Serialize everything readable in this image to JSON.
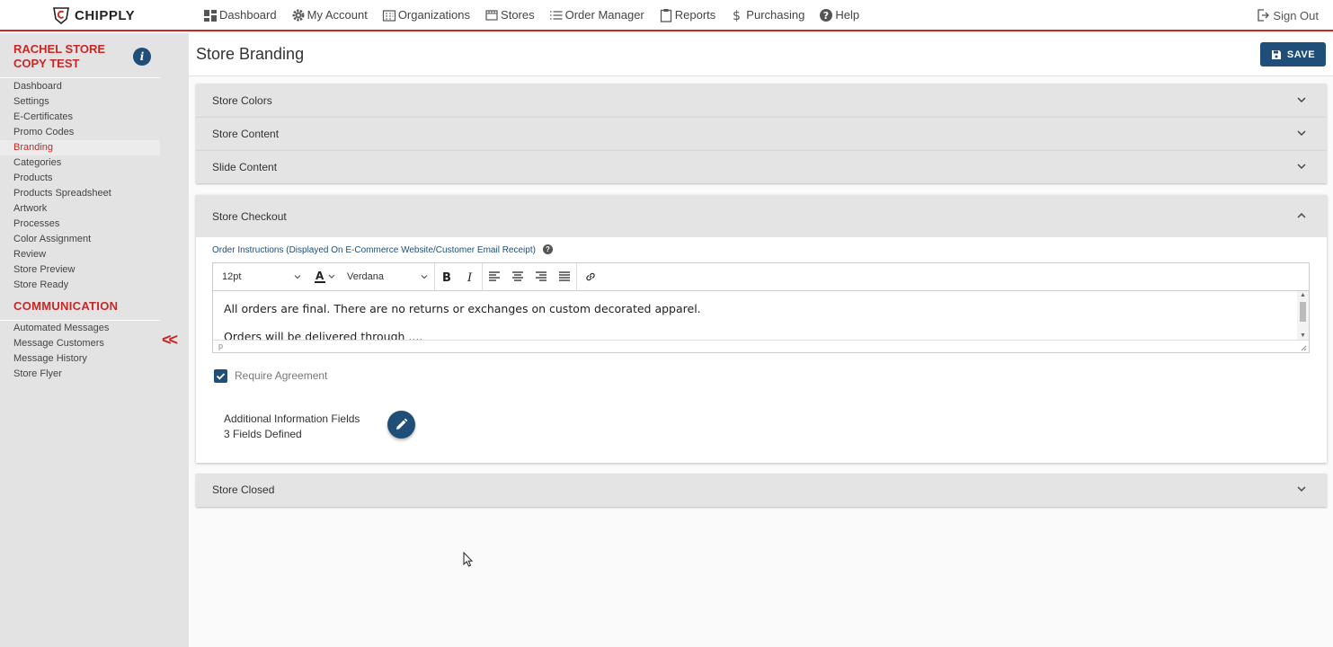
{
  "brand": {
    "name": "CHIPPLY",
    "accent_red": "#c62828",
    "primary_blue": "#1f4e79"
  },
  "nav": {
    "items": [
      {
        "label": "Dashboard",
        "icon": "dashboard-icon"
      },
      {
        "label": "My Account",
        "icon": "gear-icon"
      },
      {
        "label": "Organizations",
        "icon": "building-icon"
      },
      {
        "label": "Stores",
        "icon": "store-icon"
      },
      {
        "label": "Order Manager",
        "icon": "list-icon"
      },
      {
        "label": "Reports",
        "icon": "clipboard-icon"
      },
      {
        "label": "Purchasing",
        "icon": "dollar-icon"
      },
      {
        "label": "Help",
        "icon": "help-icon"
      }
    ],
    "signout": "Sign Out"
  },
  "sidebar": {
    "store_name": "RACHEL STORE COPY TEST",
    "items": [
      "Dashboard",
      "Settings",
      "E-Certificates",
      "Promo Codes",
      "Branding",
      "Categories",
      "Products",
      "Products Spreadsheet",
      "Artwork",
      "Processes",
      "Color Assignment",
      "Review",
      "Store Preview",
      "Store Ready"
    ],
    "active": "Branding",
    "communication_heading": "COMMUNICATION",
    "communication_items": [
      "Automated Messages",
      "Message Customers",
      "Message History",
      "Store Flyer"
    ],
    "collapse_label": "<<"
  },
  "page": {
    "title": "Store Branding",
    "save_label": "SAVE",
    "panels": [
      "Store Colors",
      "Store Content",
      "Slide Content"
    ],
    "checkout": {
      "title": "Store Checkout",
      "instructions_label": "Order Instructions (Displayed On E-Commerce Website/Customer Email Receipt)",
      "editor": {
        "font_size": "12pt",
        "font_family": "Verdana",
        "content": [
          "All orders are final. There are no returns or exchanges on custom decorated apparel.",
          "Orders will be delivered through ...."
        ],
        "status_path": "p"
      },
      "require_agreement_label": "Require Agreement",
      "require_agreement_checked": true,
      "additional_fields_title": "Additional Information Fields",
      "additional_fields_count": "3 Fields Defined"
    },
    "closed_panel": "Store Closed"
  }
}
